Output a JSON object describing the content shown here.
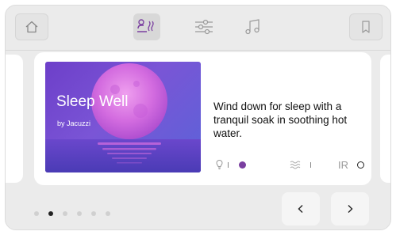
{
  "topbar": {
    "icons": [
      "home-icon",
      "soak-mode-icon",
      "sliders-icon",
      "music-icon",
      "bookmark-icon"
    ],
    "active_mode": "soak-mode"
  },
  "card": {
    "title": "Sleep Well",
    "byline": "by Jacuzzi",
    "description": "Wind down for sleep with a tranquil soak in soothing hot water.",
    "features": {
      "light": {
        "icon": "lightbulb-icon",
        "state": "on",
        "color": "#7a3fa0"
      },
      "jets": {
        "icon": "waves-icon",
        "state": "on"
      },
      "ir": {
        "label": "IR",
        "state": "off"
      }
    }
  },
  "pager": {
    "total": 6,
    "active_index": 1
  },
  "colors": {
    "accent": "#7a3fa0",
    "image_bg": "#6d3fc9"
  }
}
